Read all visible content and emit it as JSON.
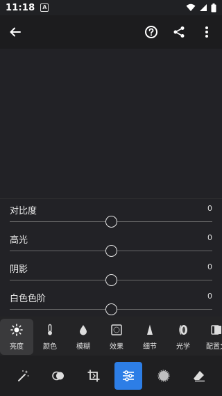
{
  "status": {
    "time": "11:18",
    "app_letter": "A"
  },
  "adjustments": [
    {
      "label": "对比度",
      "value": "0",
      "level": 0.5
    },
    {
      "label": "高光",
      "value": "0",
      "level": 0.5
    },
    {
      "label": "阴影",
      "value": "0",
      "level": 0.5
    },
    {
      "label": "白色色阶",
      "value": "0",
      "level": 0.5
    }
  ],
  "tools": [
    {
      "label": "亮度",
      "icon": "sun-icon"
    },
    {
      "label": "颜色",
      "icon": "thermometer-icon"
    },
    {
      "label": "模糊",
      "icon": "droplet-icon"
    },
    {
      "label": "效果",
      "icon": "vignette-icon"
    },
    {
      "label": "细节",
      "icon": "triangle-icon"
    },
    {
      "label": "光学",
      "icon": "lens-icon"
    },
    {
      "label": "配置文",
      "icon": "profile-icon"
    }
  ],
  "colors": {
    "accent": "#2d7ee6",
    "background": "#222226"
  }
}
